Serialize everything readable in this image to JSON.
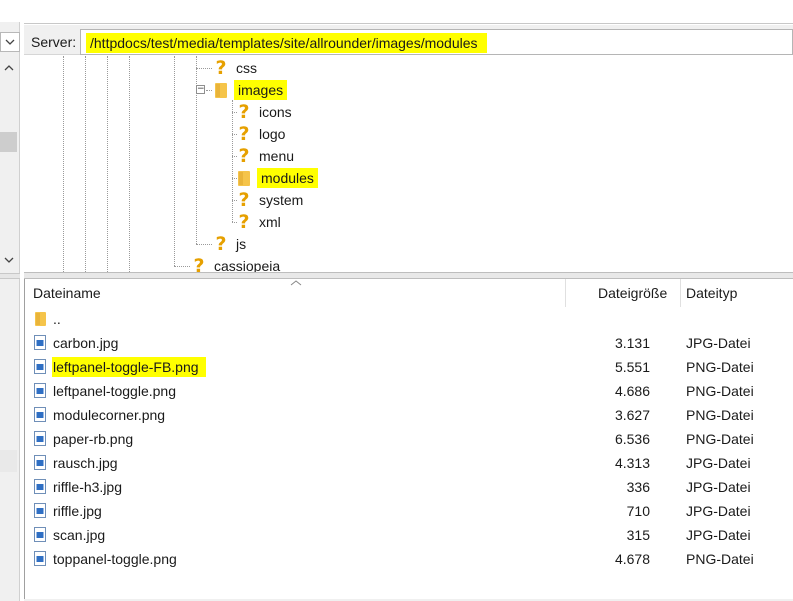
{
  "server": {
    "label": "Server:",
    "path": "/httpdocs/test/media/templates/site/allrounder/images/modules"
  },
  "tree": {
    "nodes": [
      {
        "label": "css",
        "icon": "unknown-folder-icon",
        "highlighted": false
      },
      {
        "label": "images",
        "icon": "folder-icon",
        "highlighted": true,
        "expanded": true
      },
      {
        "label": "icons",
        "icon": "unknown-folder-icon",
        "highlighted": false
      },
      {
        "label": "logo",
        "icon": "unknown-folder-icon",
        "highlighted": false
      },
      {
        "label": "menu",
        "icon": "unknown-folder-icon",
        "highlighted": false
      },
      {
        "label": "modules",
        "icon": "folder-icon",
        "highlighted": true
      },
      {
        "label": "system",
        "icon": "unknown-folder-icon",
        "highlighted": false
      },
      {
        "label": "xml",
        "icon": "unknown-folder-icon",
        "highlighted": false
      },
      {
        "label": "js",
        "icon": "unknown-folder-icon",
        "highlighted": false
      },
      {
        "label": "cassiopeia",
        "icon": "unknown-folder-icon",
        "highlighted": false
      }
    ]
  },
  "filelist": {
    "columns": {
      "name": "Dateiname",
      "size": "Dateigröße",
      "type": "Dateityp"
    },
    "parent_dir": "..",
    "files": [
      {
        "name": "carbon.jpg",
        "size": "3.131",
        "type": "JPG-Datei",
        "highlighted": false
      },
      {
        "name": "leftpanel-toggle-FB.png",
        "size": "5.551",
        "type": "PNG-Datei",
        "highlighted": true
      },
      {
        "name": "leftpanel-toggle.png",
        "size": "4.686",
        "type": "PNG-Datei",
        "highlighted": false
      },
      {
        "name": "modulecorner.png",
        "size": "3.627",
        "type": "PNG-Datei",
        "highlighted": false
      },
      {
        "name": "paper-rb.png",
        "size": "6.536",
        "type": "PNG-Datei",
        "highlighted": false
      },
      {
        "name": "rausch.jpg",
        "size": "4.313",
        "type": "JPG-Datei",
        "highlighted": false
      },
      {
        "name": "riffle-h3.jpg",
        "size": "336",
        "type": "JPG-Datei",
        "highlighted": false
      },
      {
        "name": "riffle.jpg",
        "size": "710",
        "type": "JPG-Datei",
        "highlighted": false
      },
      {
        "name": "scan.jpg",
        "size": "315",
        "type": "JPG-Datei",
        "highlighted": false
      },
      {
        "name": "toppanel-toggle.png",
        "size": "4.678",
        "type": "PNG-Datei",
        "highlighted": false
      }
    ]
  },
  "colors": {
    "highlight": "#ffff00",
    "folder": "#f5c44a",
    "unknown": "#e6a000"
  }
}
